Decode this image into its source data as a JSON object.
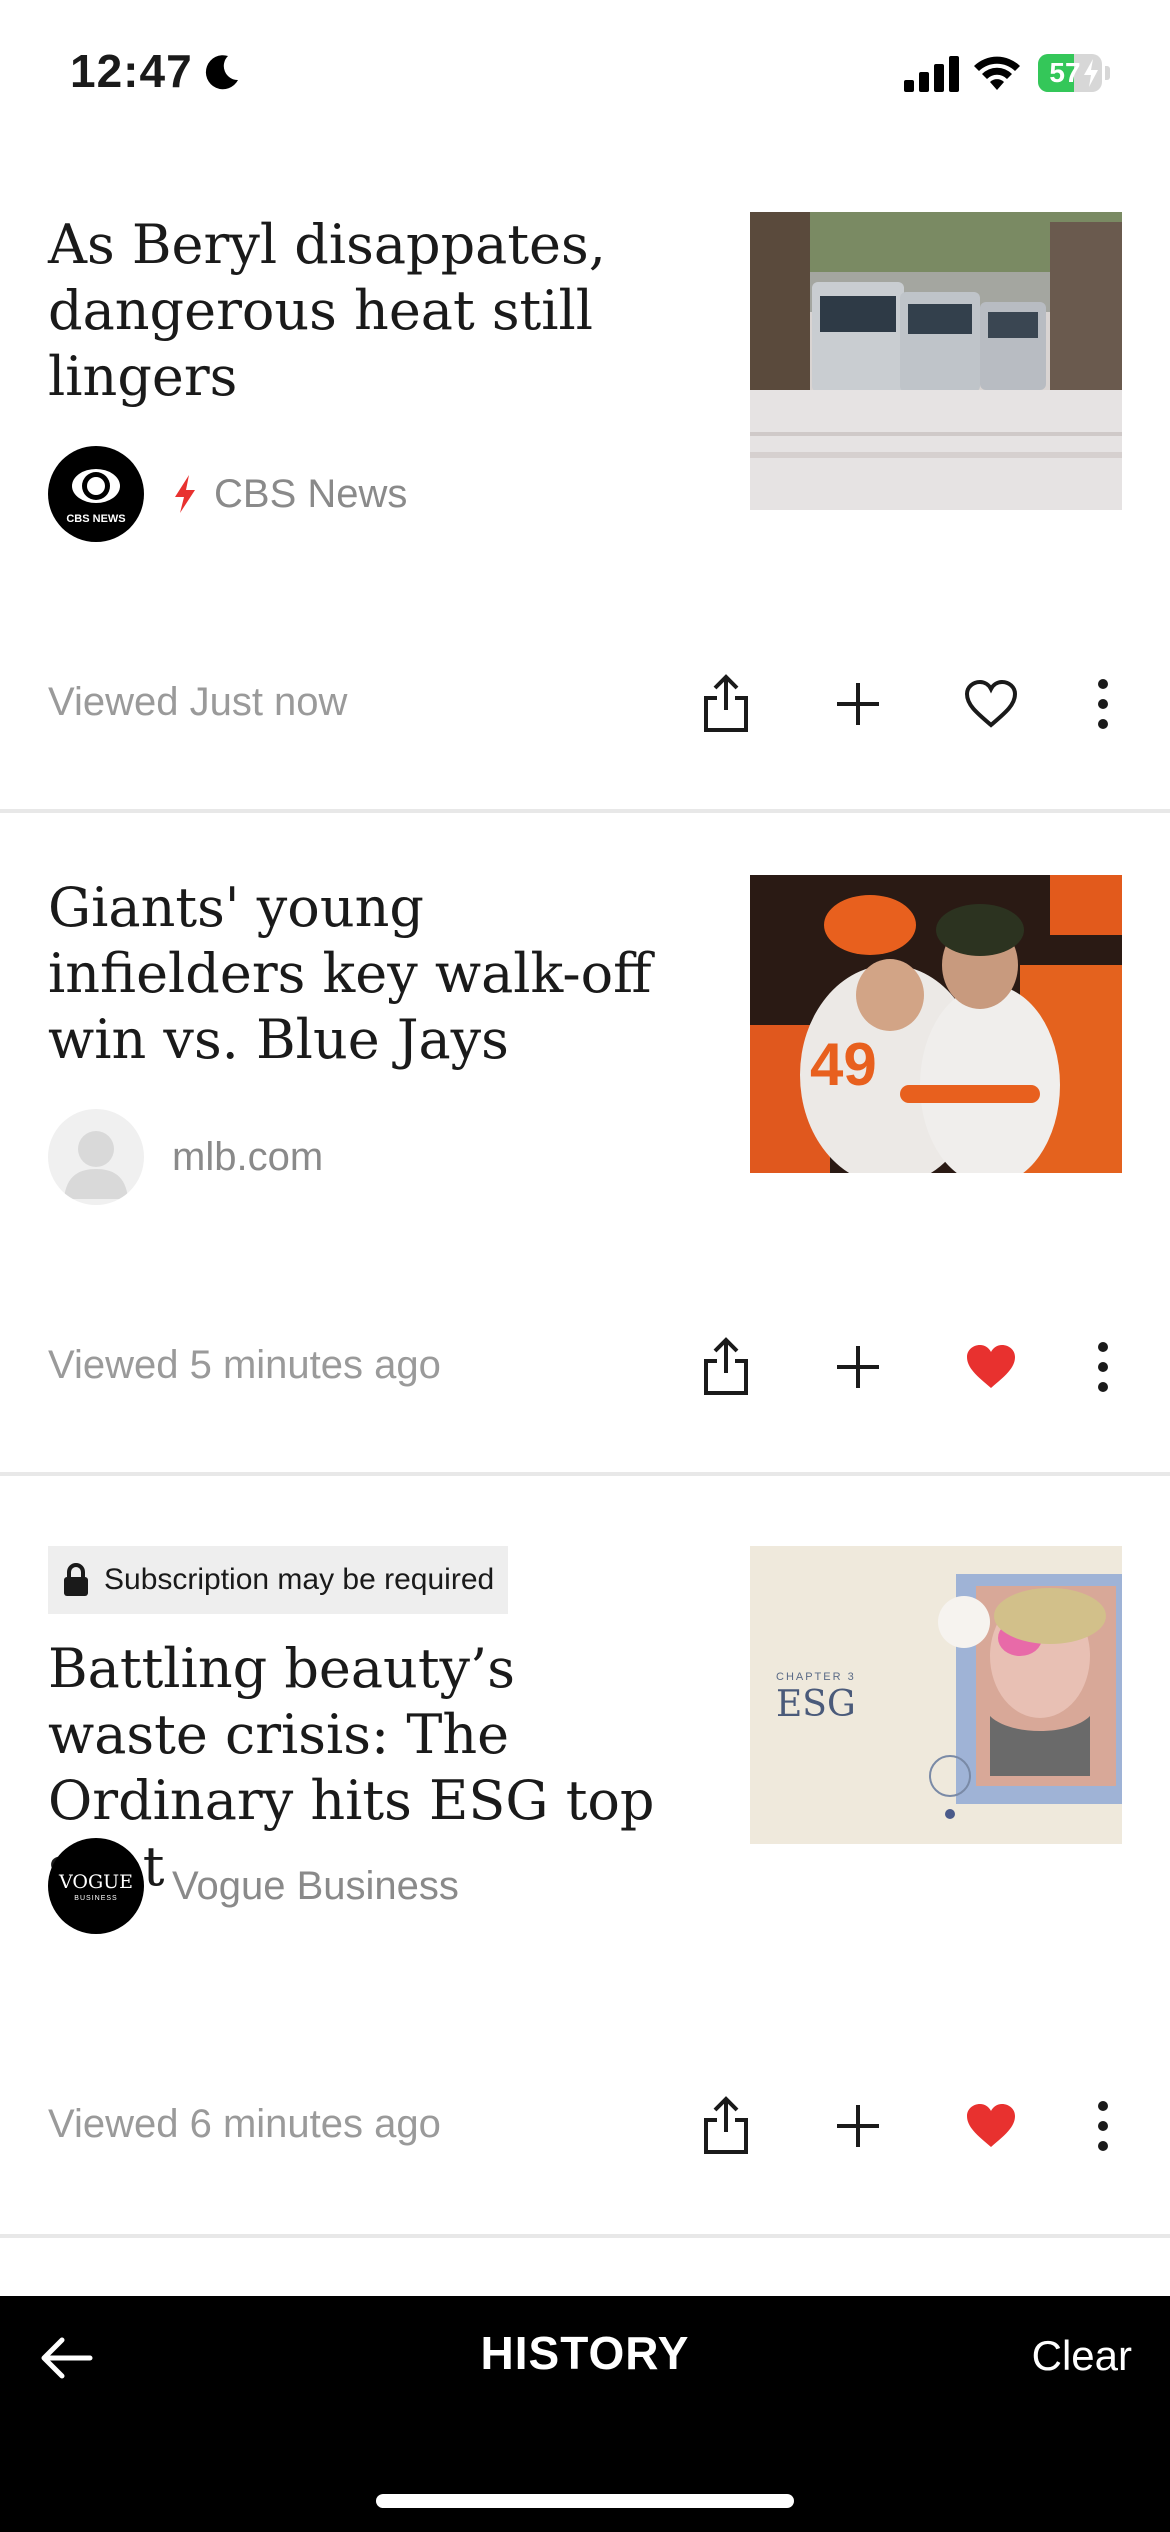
{
  "status_bar": {
    "time": "12:47",
    "battery_percent": "57",
    "battery_level": 0.57,
    "icons": [
      "moon-icon",
      "signal-icon",
      "wifi-icon",
      "battery-icon"
    ]
  },
  "articles": [
    {
      "title": "As Beryl disappates, dangerous heat still lingers",
      "source": "CBS News",
      "source_logo_text": "CBS NEWS",
      "viewed": "Viewed Just now",
      "favorited": false,
      "subscription_note": ""
    },
    {
      "title": "Giants' young infielders key walk-off win vs. Blue Jays",
      "source": "mlb.com",
      "viewed": "Viewed 5 minutes ago",
      "favorited": true,
      "subscription_note": ""
    },
    {
      "title": "Battling beauty’s waste crisis: The Ordinary hits ESG top spot",
      "source": "Vogue Business",
      "source_logo_text": "VOGUE",
      "source_logo_subtext": "BUSINESS",
      "thumb_caption_small": "CHAPTER 3",
      "thumb_caption_large": "ESG",
      "viewed": "Viewed 6 minutes ago",
      "favorited": true,
      "subscription_note": "Subscription may be required"
    }
  ],
  "bottom_bar": {
    "title": "HISTORY",
    "clear_label": "Clear"
  },
  "colors": {
    "favorite_red": "#e8312f",
    "meta_gray": "#9a9a9a",
    "bar_background": "#000000"
  }
}
